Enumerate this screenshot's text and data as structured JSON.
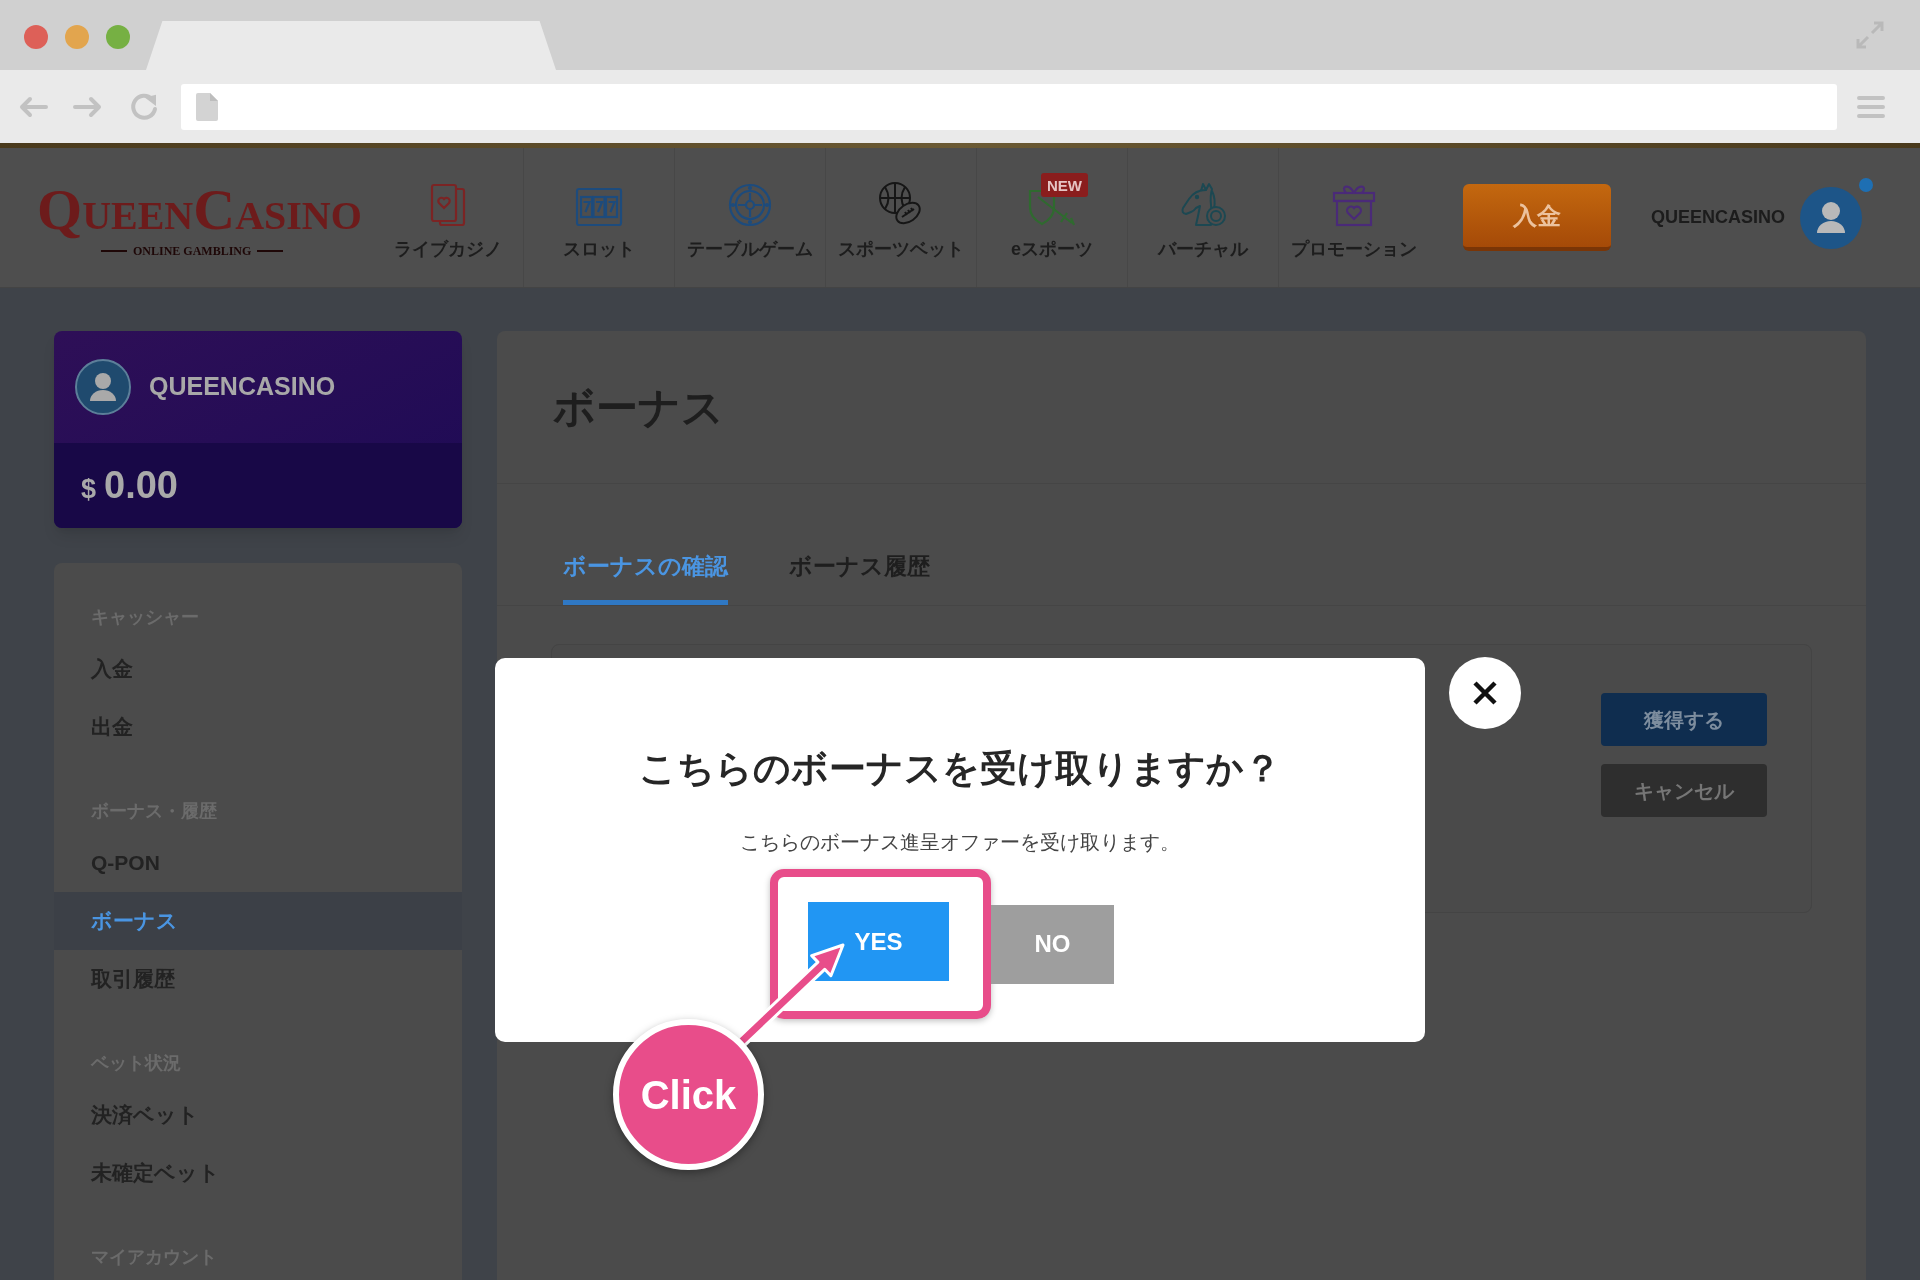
{
  "header": {
    "logo": {
      "words": [
        "QUEEN",
        "CASINO"
      ],
      "tagline": "ONLINE GAMBLING"
    },
    "nav": [
      {
        "label": "ライブカジノ"
      },
      {
        "label": "スロット"
      },
      {
        "label": "テーブルゲーム"
      },
      {
        "label": "スポーツベット"
      },
      {
        "label": "eスポーツ",
        "badge": "NEW"
      },
      {
        "label": "バーチャル"
      },
      {
        "label": "プロモーション"
      }
    ],
    "deposit_button": "入金",
    "user": {
      "name": "QUEENCASINO",
      "notification": true
    }
  },
  "sidebar": {
    "account": {
      "name": "QUEENCASINO",
      "currency": "$",
      "balance": "0.00"
    },
    "menu": [
      {
        "heading": "キャッシャー",
        "items": [
          {
            "label": "入金",
            "selected": false
          },
          {
            "label": "出金",
            "selected": false
          }
        ]
      },
      {
        "heading": "ボーナス・履歴",
        "items": [
          {
            "label": "Q-PON",
            "selected": false
          },
          {
            "label": "ボーナス",
            "selected": true
          },
          {
            "label": "取引履歴",
            "selected": false
          }
        ]
      },
      {
        "heading": "ベット状況",
        "items": [
          {
            "label": "決済ベット",
            "selected": false
          },
          {
            "label": "未確定ベット",
            "selected": false
          }
        ]
      },
      {
        "heading": "マイアカウント"
      }
    ]
  },
  "main": {
    "title": "ボーナス",
    "tabs": [
      {
        "label": "ボーナスの確認",
        "selected": true
      },
      {
        "label": "ボーナス履歴",
        "selected": false
      }
    ],
    "offer_card": {
      "buttons": [
        {
          "label": "獲得する",
          "kind": "primary"
        },
        {
          "label": "キャンセル",
          "kind": "secondary"
        }
      ]
    }
  },
  "modal": {
    "title": "こちらのボーナスを受け取りますか？",
    "message": "こちらのボーナス進呈オファーを受け取ります。",
    "buttons": [
      {
        "label": "YES",
        "kind": "confirm",
        "highlighted": true
      },
      {
        "label": "NO",
        "kind": "cancel",
        "highlighted": false
      }
    ]
  },
  "annotation": {
    "label": "Click"
  }
}
